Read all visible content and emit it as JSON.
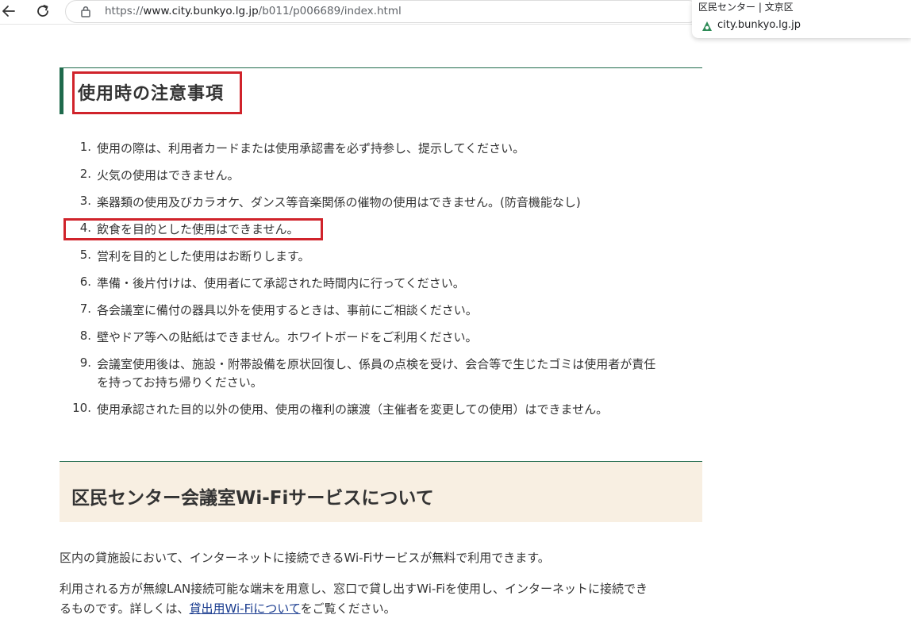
{
  "browser": {
    "url_prefix": "https://",
    "url_domain": "www.city.bunkyo.lg.jp",
    "url_path": "/b011/p006689/index.html",
    "hover_card": {
      "title": "区民センター | 文京区",
      "domain": "city.bunkyo.lg.jp"
    }
  },
  "page": {
    "top_fragment": "・ーーー",
    "section1": {
      "heading": "使用時の注意事項",
      "rules": [
        {
          "num": "1.",
          "text": "使用の際は、利用者カードまたは使用承認書を必ず持参し、提示してください。"
        },
        {
          "num": "2.",
          "text": "火気の使用はできません。"
        },
        {
          "num": "3.",
          "text": "楽器類の使用及びカラオケ、ダンス等音楽関係の催物の使用はできません。(防音機能なし)"
        },
        {
          "num": "4.",
          "text": "飲食を目的とした使用はできません。"
        },
        {
          "num": "5.",
          "text": "営利を目的とした使用はお断りします。"
        },
        {
          "num": "6.",
          "text": "準備・後片付けは、使用者にて承認された時間内に行ってください。"
        },
        {
          "num": "7.",
          "text": "各会議室に備付の器具以外を使用するときは、事前にご相談ください。"
        },
        {
          "num": "8.",
          "text": "壁やドア等への貼紙はできません。ホワイトボードをご利用ください。"
        },
        {
          "num": "9.",
          "text": "会議室使用後は、施設・附帯設備を原状回復し、係員の点検を受け、会合等で生じたゴミは使用者が責任",
          "text2": "を持ってお持ち帰りください。"
        },
        {
          "num": "10.",
          "text": "使用承認された目的以外の使用、使用の権利の譲渡（主催者を変更しての使用）はできません。"
        }
      ]
    },
    "section2": {
      "heading": "区民センター会議室Wi-Fiサービスについて",
      "para1": "区内の貸施設において、インターネットに接続できるWi-Fiサービスが無料で利用できます。",
      "para2_line1": "利用される方が無線LAN接続可能な端末を用意し、窓口で貸し出すWi-Fiを使用し、インターネットに接続でき",
      "para2_line2_before": "るものです。詳しくは、",
      "para2_link": "貸出用Wi-Fiについて",
      "para2_line2_after": "をご覧ください。"
    }
  },
  "colors": {
    "accent_green": "#1f6a4c",
    "highlight_red": "#d0232b",
    "section_bg": "#f8efe2",
    "link": "#1a3c8f"
  },
  "icons": [
    "back-arrow-icon",
    "reload-icon",
    "site-info-icon",
    "favicon-icon"
  ]
}
